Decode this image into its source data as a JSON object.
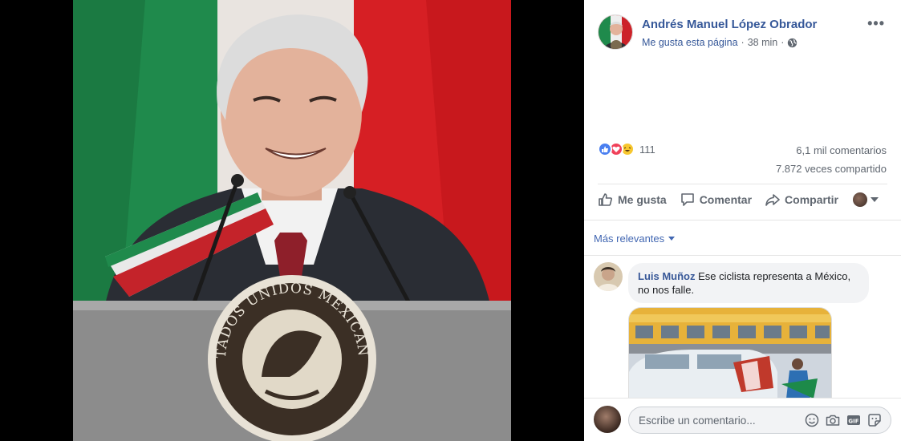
{
  "post": {
    "page_name": "Andrés Manuel López Obrador",
    "like_page_label": "Me gusta esta página",
    "separator": "·",
    "time_ago": "38 min",
    "more_label": "•••"
  },
  "stats": {
    "reactions_count": "111",
    "comments_count": "6,1 mil comentarios",
    "shares_count": "7.872 veces compartido"
  },
  "actions": {
    "like": "Me gusta",
    "comment": "Comentar",
    "share": "Compartir"
  },
  "comments_section": {
    "sort_label": "Más relevantes",
    "comments": [
      {
        "author": "Luis Muñoz",
        "text": "Ese ciclista representa a México, no nos falle."
      }
    ]
  },
  "composer": {
    "placeholder": "Escribe un comentario..."
  },
  "photo": {
    "seal_text": "ESTADOS UNIDOS MEXICANOS"
  },
  "icons": {
    "globe": "globe-icon",
    "like": "thumbs-up-icon",
    "comment": "speech-bubble-icon",
    "share": "share-arrow-icon",
    "emoji": "smiley-icon",
    "camera": "camera-icon",
    "gif": "gif-icon",
    "sticker": "sticker-icon"
  },
  "colors": {
    "link_blue": "#365899",
    "like_blue": "#4a7ff0",
    "love_red": "#f0415a",
    "haha_yellow": "#f7c72f"
  }
}
